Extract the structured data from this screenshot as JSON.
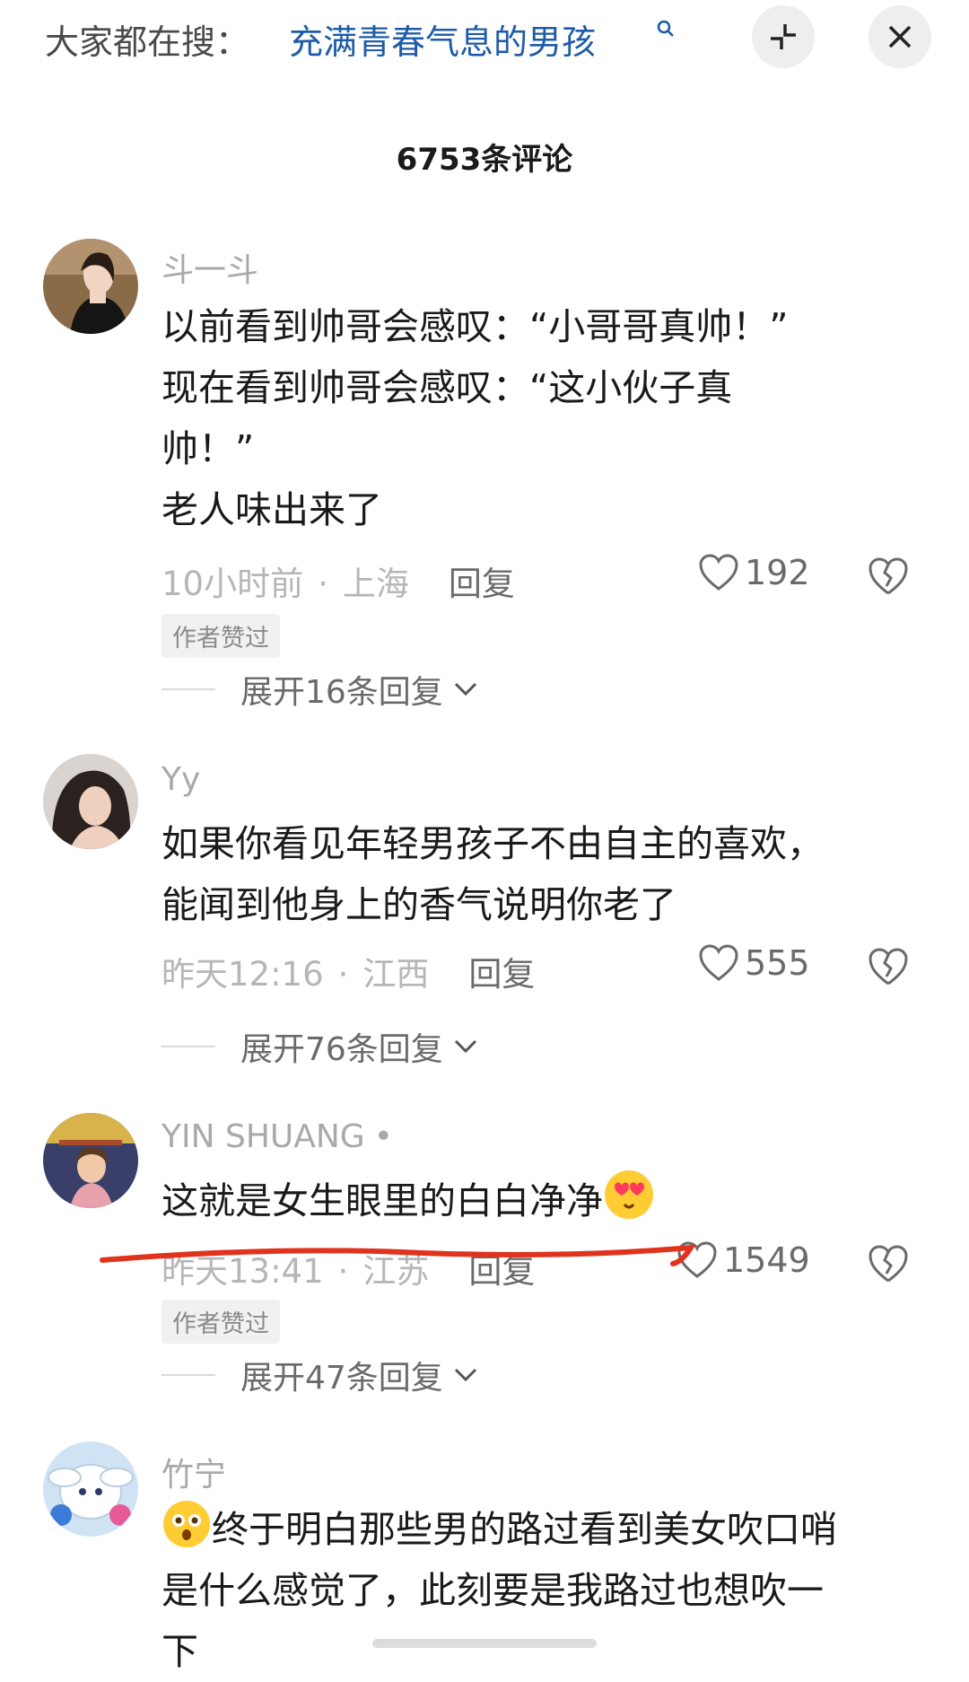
{
  "topbar": {
    "hot_prefix": "大家都在搜：",
    "hot_term": "充满青春气息的男孩"
  },
  "comments_header": {
    "count_title": "6753条评论"
  },
  "comments": [
    {
      "username": "斗一斗",
      "lines": [
        "以前看到帅哥会感叹：“小哥哥真帅！”",
        "现在看到帅哥会感叹：“这小伙子真",
        "帅！”",
        "老人味出来了"
      ],
      "time": "10小时前",
      "location": "上海",
      "reply_label": "回复",
      "likes": "192",
      "author_liked": "作者赞过",
      "expand": "展开16条回复"
    },
    {
      "username": "Yy",
      "lines": [
        "如果你看见年轻男孩子不由自主的喜欢，",
        "能闻到他身上的香气说明你老了"
      ],
      "time": "昨天12:16",
      "location": "江西",
      "reply_label": "回复",
      "likes": "555",
      "expand": "展开76条回复"
    },
    {
      "username": "YIN SHUANG",
      "lines": [
        "这就是女生眼里的白白净净"
      ],
      "time": "昨天13:41",
      "location": "江苏",
      "reply_label": "回复",
      "likes": "1549",
      "author_liked": "作者赞过",
      "expand": "展开47条回复"
    },
    {
      "username": "竹宁",
      "lines": [
        "终于明白那些男的路过看到美女吹口哨",
        "是什么感觉了，此刻要是我路过也想吹一",
        "下"
      ]
    }
  ],
  "colors": {
    "link_blue": "#1e5ba8",
    "underline_red": "#e0331e",
    "meta_gray": "#b6b6b6"
  }
}
